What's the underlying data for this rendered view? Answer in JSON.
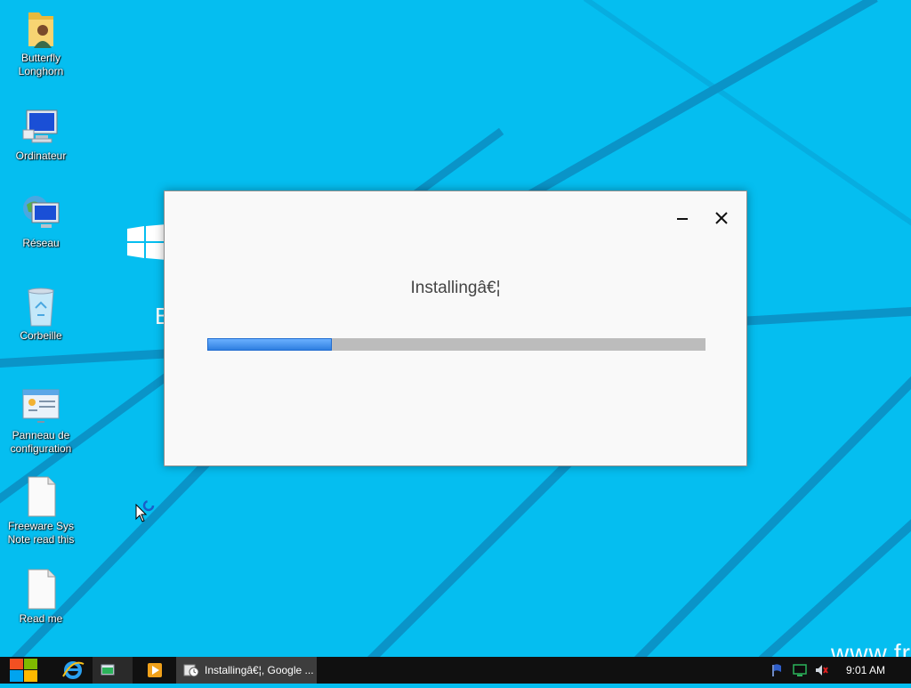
{
  "desktop": {
    "icons": [
      {
        "label": "Butterfly\nLonghorn",
        "icon": "user-folder-icon"
      },
      {
        "label": "Ordinateur",
        "icon": "computer-icon"
      },
      {
        "label": "Réseau",
        "icon": "network-icon"
      },
      {
        "label": "Corbeille",
        "icon": "recycle-bin-icon"
      },
      {
        "label": "Panneau de\nconfiguration",
        "icon": "control-panel-icon"
      },
      {
        "label": "Freeware Sys\nNote read this",
        "icon": "text-document-icon"
      },
      {
        "label": "Read me",
        "icon": "text-document-icon"
      }
    ],
    "watermark_text": "www.fr",
    "watermark_letter": "B"
  },
  "installer_dialog": {
    "title": "Installingâ€¦",
    "progress_fraction": 0.25,
    "minimize_icon": "minimize-icon",
    "close_icon": "close-icon"
  },
  "taskbar": {
    "start_icon": "windows-logo-icon",
    "pinned": [
      {
        "icon": "internet-explorer-icon"
      },
      {
        "icon": "app-window-icon"
      },
      {
        "icon": "media-player-icon"
      }
    ],
    "active_task": {
      "label": "Installingâ€¦, Google ...",
      "icon": "installer-icon"
    },
    "tray": {
      "icons": [
        "action-center-flag-icon",
        "network-monitor-icon",
        "volume-muted-icon"
      ],
      "clock": "9:01 AM"
    }
  },
  "colors": {
    "desktop_background": "#05bef0",
    "progress_fill": "#2f7fe0",
    "progress_track": "#bcbcbc",
    "taskbar": "#101010"
  }
}
